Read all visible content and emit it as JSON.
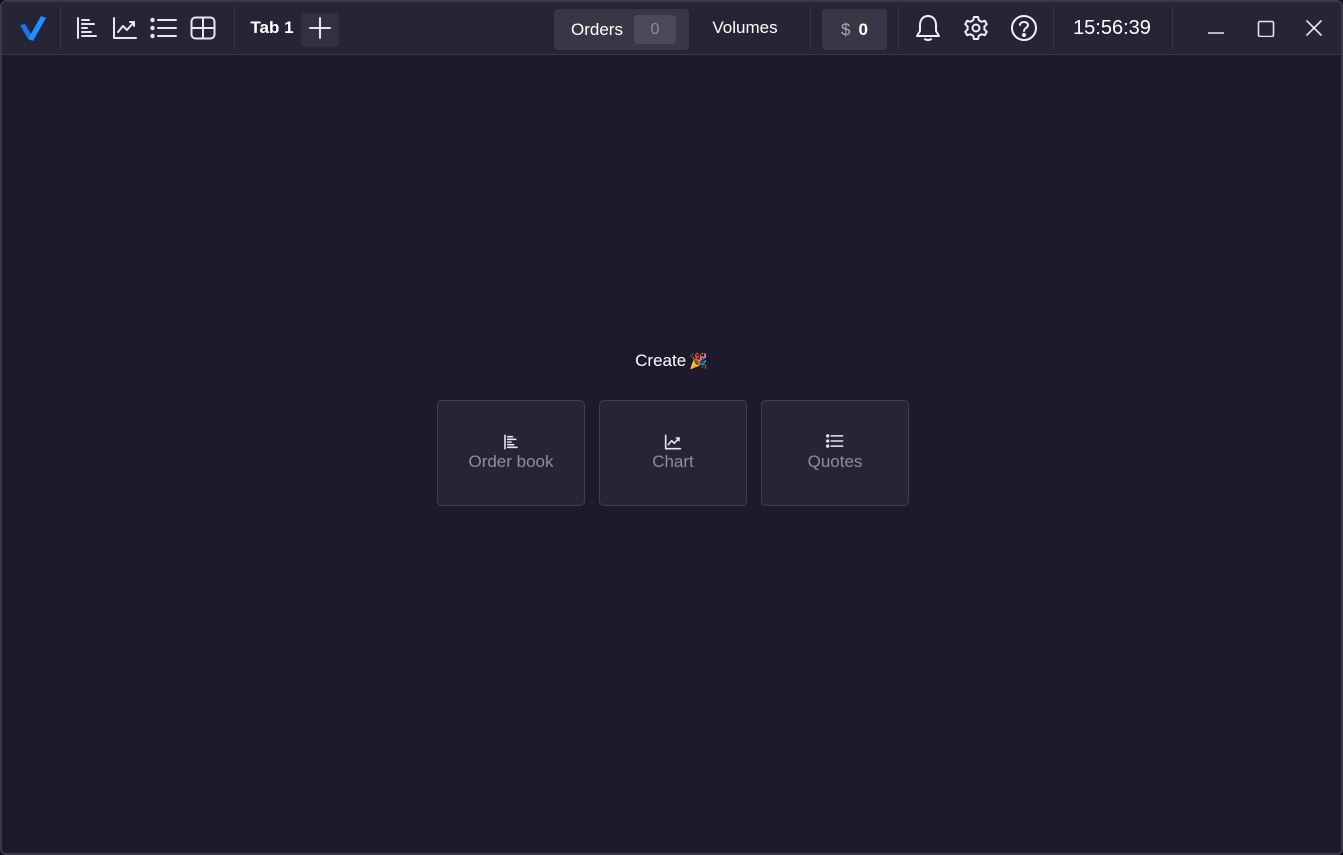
{
  "toolbar": {
    "logo_icon": "app-logo-check",
    "tools": [
      {
        "name": "order-book-tool",
        "icon": "order-book-icon"
      },
      {
        "name": "chart-tool",
        "icon": "chart-icon"
      },
      {
        "name": "quotes-tool",
        "icon": "list-icon"
      },
      {
        "name": "layout-tool",
        "icon": "grid-icon"
      }
    ],
    "tab_label": "Tab 1",
    "add_tab_icon": "plus-icon",
    "orders_label": "Orders",
    "orders_count": "0",
    "volumes_label": "Volumes",
    "balance_currency": "$",
    "balance_value": "0",
    "clock": "15:56:39",
    "icons": [
      "bell-icon",
      "gear-icon",
      "help-icon"
    ],
    "window_controls": [
      "minimize-icon",
      "maximize-icon",
      "close-icon"
    ]
  },
  "workspace": {
    "create_title": "Create",
    "create_emoji": "🎉",
    "cards": [
      {
        "label": "Order book",
        "icon": "order-book-icon"
      },
      {
        "label": "Chart",
        "icon": "chart-icon"
      },
      {
        "label": "Quotes",
        "icon": "list-icon"
      }
    ]
  },
  "colors": {
    "background": "#1c1a2b",
    "topbar": "#262535",
    "accent": "#1e88ff",
    "text": "#ffffff",
    "muted_text": "#8e8d9b"
  }
}
